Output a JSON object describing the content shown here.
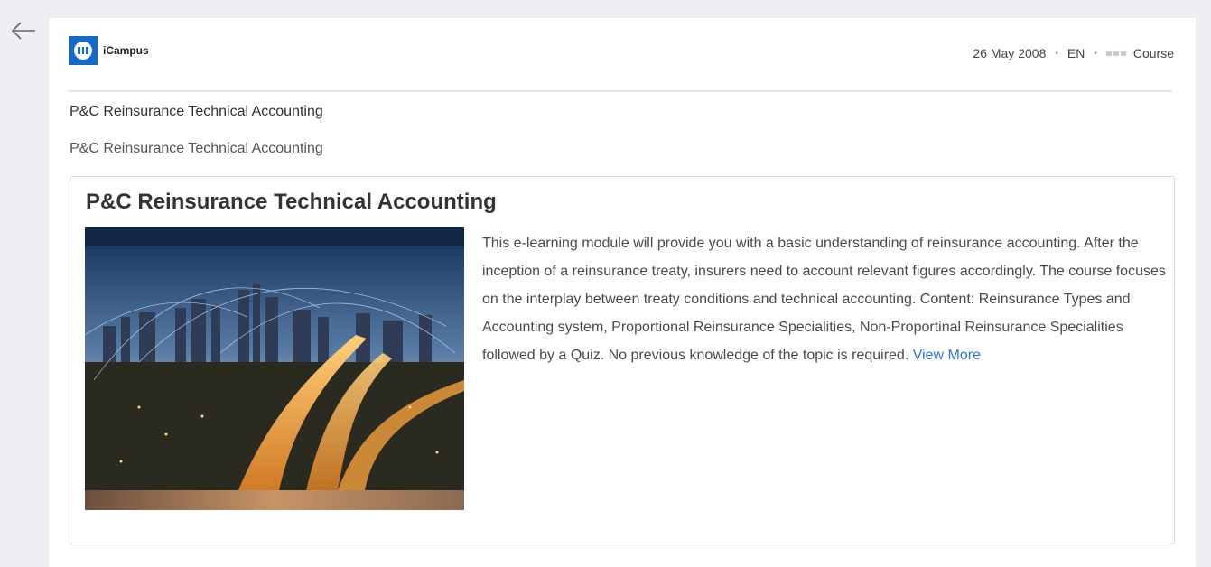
{
  "nav": {
    "back_icon": "arrow-left-icon"
  },
  "header": {
    "logo_icon": "university-icon",
    "logo_text": "iCampus",
    "date": "26 May 2008",
    "separator": "•",
    "language": "EN",
    "type_icon": "course-type-icon",
    "type_label": "Course"
  },
  "breadcrumbs": {
    "primary": "P&C Reinsurance Technical Accounting",
    "secondary": "P&C Reinsurance Technical Accounting"
  },
  "course": {
    "title": "P&C Reinsurance Technical Accounting",
    "description": "This e-learning module will provide you with a basic understanding of reinsurance accounting. After the inception of a reinsurance treaty, insurers need to account relevant figures accordingly. The course focuses on the interplay between treaty conditions and technical accounting. Content: Reinsurance Types and Accounting system, Proportional Reinsurance Specialities, Non-Proportinal Reinsurance Specialities followed by a Quiz. No previous knowledge of the topic is required.",
    "view_more": "View More"
  },
  "colors": {
    "brand": "#1769c7",
    "link": "#2b78d6",
    "background": "#efeff3"
  }
}
